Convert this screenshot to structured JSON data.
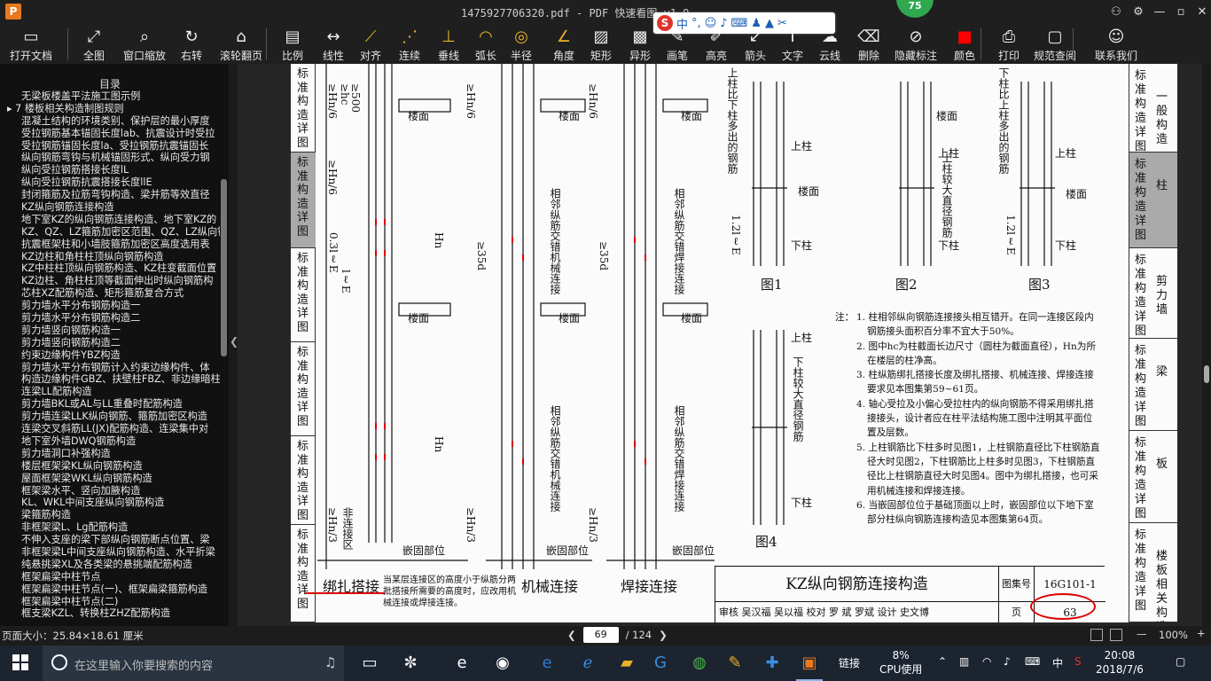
{
  "titlebar": {
    "title": "1475927706320.pdf - PDF 快速看图 v1.9",
    "badge": "75",
    "logo": "P"
  },
  "ime": {
    "lang": "中",
    "punct": "°,"
  },
  "toolbar": [
    {
      "label": "打开文档",
      "icon": "folder-icon",
      "glyph": "▭"
    },
    {
      "label": "全图",
      "icon": "fit-icon",
      "glyph": "⤢"
    },
    {
      "label": "窗口缩放",
      "icon": "zoom-icon",
      "glyph": "⌕"
    },
    {
      "label": "右转",
      "icon": "rotate-icon",
      "glyph": "↻"
    },
    {
      "label": "滚轮翻页",
      "icon": "mouse-icon",
      "glyph": "⌂"
    },
    {
      "label": "比例",
      "icon": "scale-icon",
      "glyph": "▤"
    },
    {
      "label": "线性",
      "icon": "linear-icon",
      "glyph": "↔"
    },
    {
      "label": "对齐",
      "icon": "align-icon",
      "glyph": "⟋"
    },
    {
      "label": "连续",
      "icon": "continuous-icon",
      "glyph": "⋰"
    },
    {
      "label": "垂线",
      "icon": "perpendicular-icon",
      "glyph": "⊥"
    },
    {
      "label": "弧长",
      "icon": "arc-icon",
      "glyph": "◠"
    },
    {
      "label": "半径",
      "icon": "radius-icon",
      "glyph": "◎"
    },
    {
      "label": "角度",
      "icon": "angle-icon",
      "glyph": "∠"
    },
    {
      "label": "矩形",
      "icon": "rectangle-icon",
      "glyph": "▨"
    },
    {
      "label": "异形",
      "icon": "polygon-icon",
      "glyph": "▩"
    },
    {
      "label": "画笔",
      "icon": "brush-icon",
      "glyph": "✎"
    },
    {
      "label": "高亮",
      "icon": "highlight-icon",
      "glyph": "✐"
    },
    {
      "label": "箭头",
      "icon": "arrow-icon",
      "glyph": "↙"
    },
    {
      "label": "文字",
      "icon": "text-icon",
      "glyph": "T"
    },
    {
      "label": "云线",
      "icon": "cloud-icon",
      "glyph": "☁"
    },
    {
      "label": "删除",
      "icon": "eraser-icon",
      "glyph": "⌫"
    },
    {
      "label": "隐藏标注",
      "icon": "hide-icon",
      "glyph": "⊘"
    },
    {
      "label": "颜色",
      "icon": "color-icon",
      "glyph": "■"
    },
    {
      "label": "打印",
      "icon": "print-icon",
      "glyph": "⎙"
    },
    {
      "label": "规范查阅",
      "icon": "book-icon",
      "glyph": "▢"
    },
    {
      "label": "联系我们",
      "icon": "contact-icon",
      "glyph": "☺"
    }
  ],
  "sidebar": {
    "title": "目录",
    "items": [
      "无梁板楼盖平法施工图示例",
      "7 楼板相关构造制图规则",
      "混凝土结构的环境类别、保护层的最小厚度",
      "受拉钢筋基本锚固长度lab、抗震设计时受拉",
      "受拉钢筋锚固长度la、受拉钢筋抗震锚固长",
      "纵向钢筋弯钩与机械锚固形式、纵向受力钢",
      "纵向受拉钢筋搭接长度lL",
      "纵向受拉钢筋抗震搭接长度llE",
      "封闭箍筋及拉筋弯钩构造、梁并筋等效直径",
      "KZ纵向钢筋连接构造",
      "地下室KZ的纵向钢筋连接构造、地下室KZ的",
      "KZ、QZ、LZ箍筋加密区范围、QZ、LZ纵向钢",
      "抗震框架柱和小墙肢箍筋加密区高度选用表",
      "KZ边柱和角柱柱顶纵向钢筋构造",
      "KZ中柱柱顶纵向钢筋构造、KZ柱变截面位置",
      "KZ边柱、角柱柱顶等截面伸出时纵向钢筋构",
      "芯柱XZ配筋构造、矩形箍筋复合方式",
      "剪力墙水平分布钢筋构造一",
      "剪力墙水平分布钢筋构造二",
      "剪力墙竖向钢筋构造一",
      "剪力墙竖向钢筋构造二",
      "约束边缘构件YBZ构造",
      "剪力墙水平分布钢筋计入约束边缘构件、体",
      "构造边缘构件GBZ、扶壁柱FBZ、非边缘暗柱",
      "连梁LL配筋构造",
      "剪力墙BKL或AL与LL重叠时配筋构造",
      "剪力墙连梁LLK纵向钢筋、箍筋加密区构造",
      "连梁交叉斜筋LL(JX)配筋构造、连梁集中对",
      "地下室外墙DWQ钢筋构造",
      "剪力墙洞口补强构造",
      "楼层框架梁KL纵向钢筋构造",
      "屋面框架梁WKL纵向钢筋构造",
      "框架梁水平、竖向加腋构造",
      "KL、WKL中间支座纵向钢筋构造",
      "梁箍筋构造",
      "非框架梁L、Lg配筋构造",
      "不伸入支座的梁下部纵向钢筋断点位置、梁",
      "非框架梁L中间支座纵向钢筋构造、水平折梁",
      "纯悬挑梁XL及各类梁的悬挑端配筋构造",
      "框架扁梁中柱节点",
      "框架扁梁中柱节点(一)、框架扁梁箍筋构造",
      "框架扁梁中柱节点(二)",
      "框支梁KZL、转换柱ZHZ配筋构造"
    ]
  },
  "page": {
    "left_tabs": [
      "标准构造详图",
      "标准构造详图",
      "标准构造详图",
      "标准构造详图",
      "标准构造详图",
      "标准构造详图"
    ],
    "right_tabs": [
      {
        "a": "标准构造详图",
        "b": "一般构造"
      },
      {
        "a": "标准构造详图",
        "b": "柱"
      },
      {
        "a": "标准构造详图",
        "b": "剪力墙"
      },
      {
        "a": "标准构造详图",
        "b": "梁"
      },
      {
        "a": "标准构造详图",
        "b": "板"
      },
      {
        "a": "标准构造详图",
        "b": "楼板相关构造"
      }
    ],
    "captions": {
      "bind": "绑扎搭接",
      "mech": "机械连接",
      "weld": "焊接连接",
      "fig1": "图1",
      "fig2": "图2",
      "fig3": "图3",
      "fig4": "图4",
      "bind_note": "当某层连接区的高度小于纵筋分两批搭接所需要的高度时，应改用机械连接或焊接连接。"
    },
    "labels": {
      "floor": "楼面",
      "upper_col": "上柱",
      "lower_col": "下柱",
      "anchor": "嵌固部位",
      "non_conn": "非连接区",
      "hn6": "≥Hn/6",
      "hc": "≥hc",
      "d500": "≥500",
      "hn3": "≥Hn/3",
      "hn": "Hn",
      "d35": "≥35d",
      "d500b": "≥500",
      "lle": "0.3lℓE",
      "lle2": "lℓE",
      "v_mech": "相邻纵筋交错机械连接",
      "v_weld": "相邻纵筋交错焊接连接",
      "v_fig1": "上柱比下柱多出的钢筋",
      "v_fig2": "上柱较大直径钢筋",
      "v_fig3": "下柱比上柱多出的钢筋",
      "v_fig4": "下柱较大直径钢筋",
      "v_12le": "1.2lℓE"
    },
    "notes": {
      "head": "注：",
      "items": [
        "1. 柱相邻纵向钢筋连接接头相互错开。在同一连接区段内钢筋接头面积百分率不宜大于50%。",
        "2. 图中hc为柱截面长边尺寸（圆柱为截面直径），Hn为所在楼层的柱净高。",
        "3. 柱纵筋绑扎搭接长度及绑扎搭接、机械连接、焊接连接要求见本图集第59~61页。",
        "4. 轴心受拉及小偏心受拉柱内的纵向钢筋不得采用绑扎搭接接头，设计者应在柱平法结构施工图中注明其平面位置及层数。",
        "5. 上柱钢筋比下柱多时见图1，上柱钢筋直径比下柱钢筋直径大时见图2，下柱钢筋比上柱多时见图3，下柱钢筋直径比上柱钢筋直径大时见图4。图中为绑扎搭接，也可采用机械连接和焊接连接。",
        "6. 当嵌固部位位于基础顶面以上时，嵌固部位以下地下室部分柱纵向钢筋连接构造见本图集第64页。"
      ]
    },
    "titleblock": {
      "title": "KZ纵向钢筋连接构造",
      "atlas_label": "图集号",
      "atlas_no": "16G101-1",
      "page_label": "页",
      "page_no": "63",
      "signatures": "审核 吴汉福 吴以福 校对 罗 斌 罗斌 设计 史文博"
    }
  },
  "statusbar": {
    "page_size": "页面大小：25.84×18.61 厘米",
    "current_page": "69",
    "total_pages": "/ 124",
    "zoom": "100%"
  },
  "taskbar": {
    "search_placeholder": "在这里输入你要搜索的内容",
    "link_label": "链接",
    "cpu_percent": "8%",
    "cpu_label": "CPU使用",
    "ime_lang": "中",
    "time": "20:08",
    "date": "2018/7/6"
  }
}
